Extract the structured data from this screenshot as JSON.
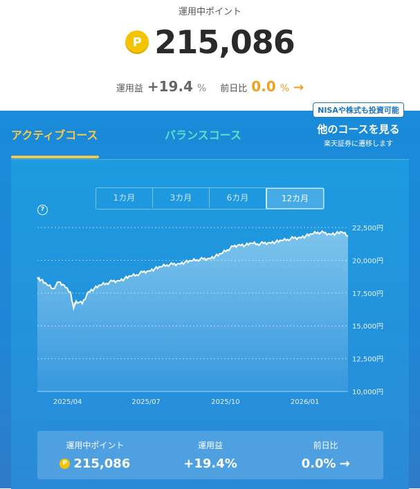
{
  "header": {
    "caption": "運用中ポイント",
    "coin_symbol": "P",
    "balance": "215,086",
    "gain_label": "運用益",
    "gain_value": "+19.4",
    "gain_unit": "%",
    "day_label": "前日比",
    "day_value": "0.0",
    "day_unit": "%",
    "day_arrow": "→"
  },
  "tabs": {
    "active": "アクティブコース",
    "balance": "バランスコース",
    "other_badge": "NISAや株式も投資可能",
    "other_title": "他のコースを見る",
    "other_sub": "楽天証券に遷移します"
  },
  "periods": [
    "1カ月",
    "3カ月",
    "6カ月",
    "12カ月"
  ],
  "active_period": "12カ月",
  "help_icon": "?",
  "chart_data": {
    "type": "area",
    "x": [
      "2025-02-25",
      "2025-03-01",
      "2025-03-08",
      "2025-03-15",
      "2025-03-22",
      "2025-03-28",
      "2025-04-04",
      "2025-04-08",
      "2025-04-11",
      "2025-04-18",
      "2025-04-25",
      "2025-05-02",
      "2025-05-09",
      "2025-05-16",
      "2025-05-23",
      "2025-05-30",
      "2025-06-06",
      "2025-06-13",
      "2025-06-20",
      "2025-06-27",
      "2025-07-04",
      "2025-07-11",
      "2025-07-18",
      "2025-07-25",
      "2025-08-01",
      "2025-08-08",
      "2025-08-15",
      "2025-08-22",
      "2025-08-29",
      "2025-09-05",
      "2025-09-12",
      "2025-09-19",
      "2025-09-26",
      "2025-10-03",
      "2025-10-10",
      "2025-10-17",
      "2025-10-24",
      "2025-10-31",
      "2025-11-07",
      "2025-11-14",
      "2025-11-21",
      "2025-11-28",
      "2025-12-05",
      "2025-12-12",
      "2025-12-19",
      "2025-12-26",
      "2026-01-02",
      "2026-01-09",
      "2026-01-16",
      "2026-01-23",
      "2026-01-30",
      "2026-02-06",
      "2026-02-13",
      "2026-02-20"
    ],
    "y": [
      18700,
      18500,
      18150,
      17850,
      18350,
      18100,
      17600,
      16350,
      16900,
      16700,
      17600,
      17850,
      18100,
      18250,
      18400,
      18450,
      18600,
      18800,
      18900,
      19100,
      19200,
      19350,
      19500,
      19650,
      19700,
      19750,
      19850,
      19950,
      20050,
      20100,
      20150,
      20300,
      20500,
      20800,
      21050,
      21200,
      21150,
      21300,
      21250,
      21300,
      21350,
      21400,
      21500,
      21600,
      21700,
      21750,
      21850,
      22000,
      22150,
      22100,
      22000,
      22050,
      22150,
      21850
    ],
    "ylim": [
      10000,
      22500
    ],
    "y_ticks": [
      "10,000円",
      "12,500円",
      "15,000円",
      "17,500円",
      "20,000円",
      "22,500円"
    ],
    "y_tick_values": [
      10000,
      12500,
      15000,
      17500,
      20000,
      22500
    ],
    "x_ticks": [
      "2025/04",
      "2025/07",
      "2025/10",
      "2026/01"
    ],
    "x_tick_dates": [
      "2025-04-01",
      "2025-07-01",
      "2025-10-01",
      "2026-01-01"
    ],
    "grid": true,
    "colors": {
      "line": "#ffffff",
      "fill_top": "#ffffff",
      "grid": "#9fd3f3"
    }
  },
  "stats": [
    {
      "label": "運用中ポイント",
      "value": "215,086",
      "coin": true
    },
    {
      "label": "運用益",
      "value": "+19.4%"
    },
    {
      "label": "前日比",
      "value": "0.0%",
      "arrow": "→"
    }
  ]
}
